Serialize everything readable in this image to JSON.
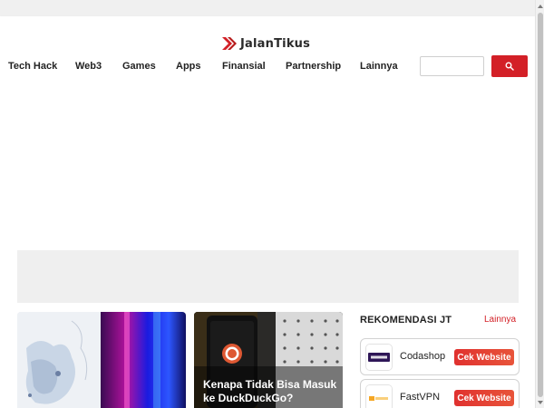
{
  "brand": {
    "logo_text": "JalanTikus",
    "accent_color": "#d32027"
  },
  "nav": {
    "items": [
      {
        "label": "Tech Hack"
      },
      {
        "label": "Web3"
      },
      {
        "label": "Games"
      },
      {
        "label": "Apps"
      },
      {
        "label": "Finansial"
      },
      {
        "label": "Partnership"
      },
      {
        "label": "Lainnya"
      }
    ]
  },
  "search": {
    "placeholder": "",
    "button_icon": "search-icon"
  },
  "articles": [
    {
      "title": ""
    },
    {
      "title": "Kenapa Tidak Bisa Masuk ke DuckDuckGo?"
    }
  ],
  "rekomendasi": {
    "title": "REKOMENDASI JT",
    "more_label": "Lainnya",
    "items": [
      {
        "name": "Codashop",
        "button": "Cek Website"
      },
      {
        "name": "FastVPN",
        "button": "Cek Website"
      }
    ]
  }
}
